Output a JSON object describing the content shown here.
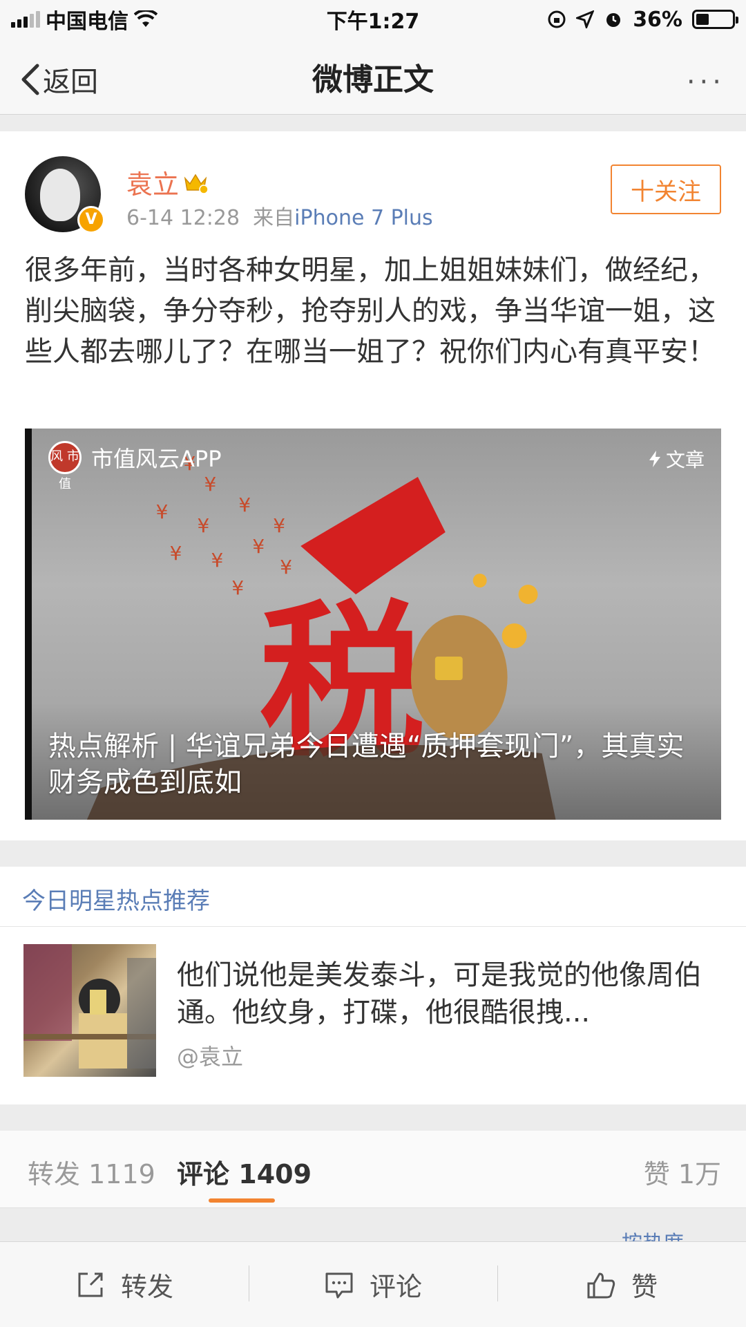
{
  "status_bar": {
    "carrier": "中国电信",
    "time": "下午1:27",
    "battery_percent": "36%",
    "battery_level": 0.36
  },
  "nav": {
    "back_label": "返回",
    "title": "微博正文",
    "more_label": "···"
  },
  "post": {
    "user_name": "袁立",
    "verified_badge": "V",
    "date": "6-14 12:28",
    "source_prefix": "来自",
    "source_device": "iPhone 7 Plus",
    "follow_label": "十关注",
    "text": "很多年前，当时各种女明星，加上姐姐妹妹们，做经纪，削尖脑袋，争分夺秒，抢夺别人的戏，争当华谊一姐，这些人都去哪儿了？在哪当一姐了？祝你们内心有真平安！",
    "article": {
      "source_name": "市值风云APP",
      "source_logo_text": "风 市 值",
      "tag": "文章",
      "title": "热点解析 | 华谊兄弟今日遭遇“质押套现门”，其真实财务成色到底如",
      "art_text": "税"
    }
  },
  "recommend": {
    "header": "今日明星热点推荐",
    "item_text": "他们说他是美发泰斗，可是我觉的他像周伯通。他纹身，打碟，他很酷很拽...",
    "item_author": "@袁立"
  },
  "stats": {
    "repost_label": "转发",
    "repost_count": "1119",
    "comment_label": "评论",
    "comment_count": "1409",
    "like_label": "赞",
    "like_count": "1万",
    "sort_label": "按热度"
  },
  "toolbar": {
    "repost": "转发",
    "comment": "评论",
    "like": "赞"
  },
  "colors": {
    "accent_orange": "#f28431",
    "username_orange": "#eb7350",
    "link_blue": "#5a7db6"
  }
}
